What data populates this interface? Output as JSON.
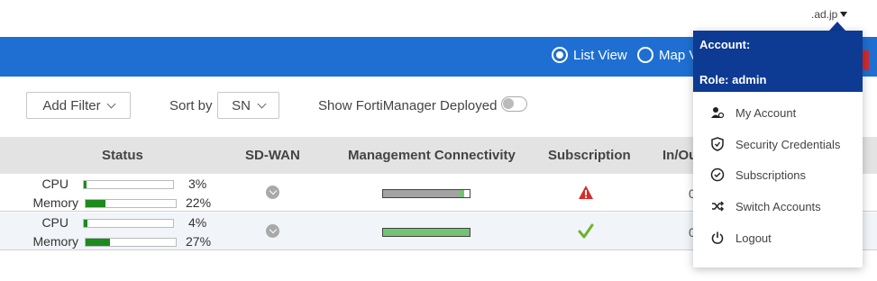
{
  "account_toggle": {
    "text": ".ad.jp"
  },
  "view": {
    "list_label": "List View",
    "map_label": "Map V"
  },
  "toolbar": {
    "add_filter": "Add Filter",
    "sort_label": "Sort by",
    "sort_value": "SN",
    "show_fm_label": "Show FortiManager Deployed"
  },
  "table": {
    "columns": [
      "Status",
      "SD-WAN",
      "Management Connectivity",
      "Subscription",
      "In/Ou"
    ],
    "rows": [
      {
        "cpu_label": "CPU",
        "cpu_value": "3%",
        "cpu_pct": 3,
        "memory_label": "Memory",
        "memory_value": "22%",
        "memory_pct": 22,
        "mgmt_connectivity": "partial",
        "subscription_status": "warning",
        "cutoff": "0"
      },
      {
        "cpu_label": "CPU",
        "cpu_value": "4%",
        "cpu_pct": 4,
        "memory_label": "Memory",
        "memory_value": "27%",
        "memory_pct": 27,
        "mgmt_connectivity": "connected",
        "subscription_status": "ok",
        "cutoff": "0"
      }
    ]
  },
  "account_menu": {
    "account_label": "Account:",
    "role_label": "Role: admin",
    "items": [
      {
        "label": "My Account",
        "icon": "user-icon"
      },
      {
        "label": "Security Credentials",
        "icon": "shield-icon"
      },
      {
        "label": "Subscriptions",
        "icon": "check-circle-icon"
      },
      {
        "label": "Switch Accounts",
        "icon": "shuffle-icon"
      },
      {
        "label": "Logout",
        "icon": "power-icon"
      }
    ]
  },
  "colors": {
    "banner": "#1e6fd1",
    "menu_header": "#0d3a92",
    "meter_fill": "#1d8a1d",
    "conn_ok": "#74c274",
    "conn_partial": "#a3a3a3",
    "warning": "#d62d2d",
    "check": "#71b22a"
  }
}
